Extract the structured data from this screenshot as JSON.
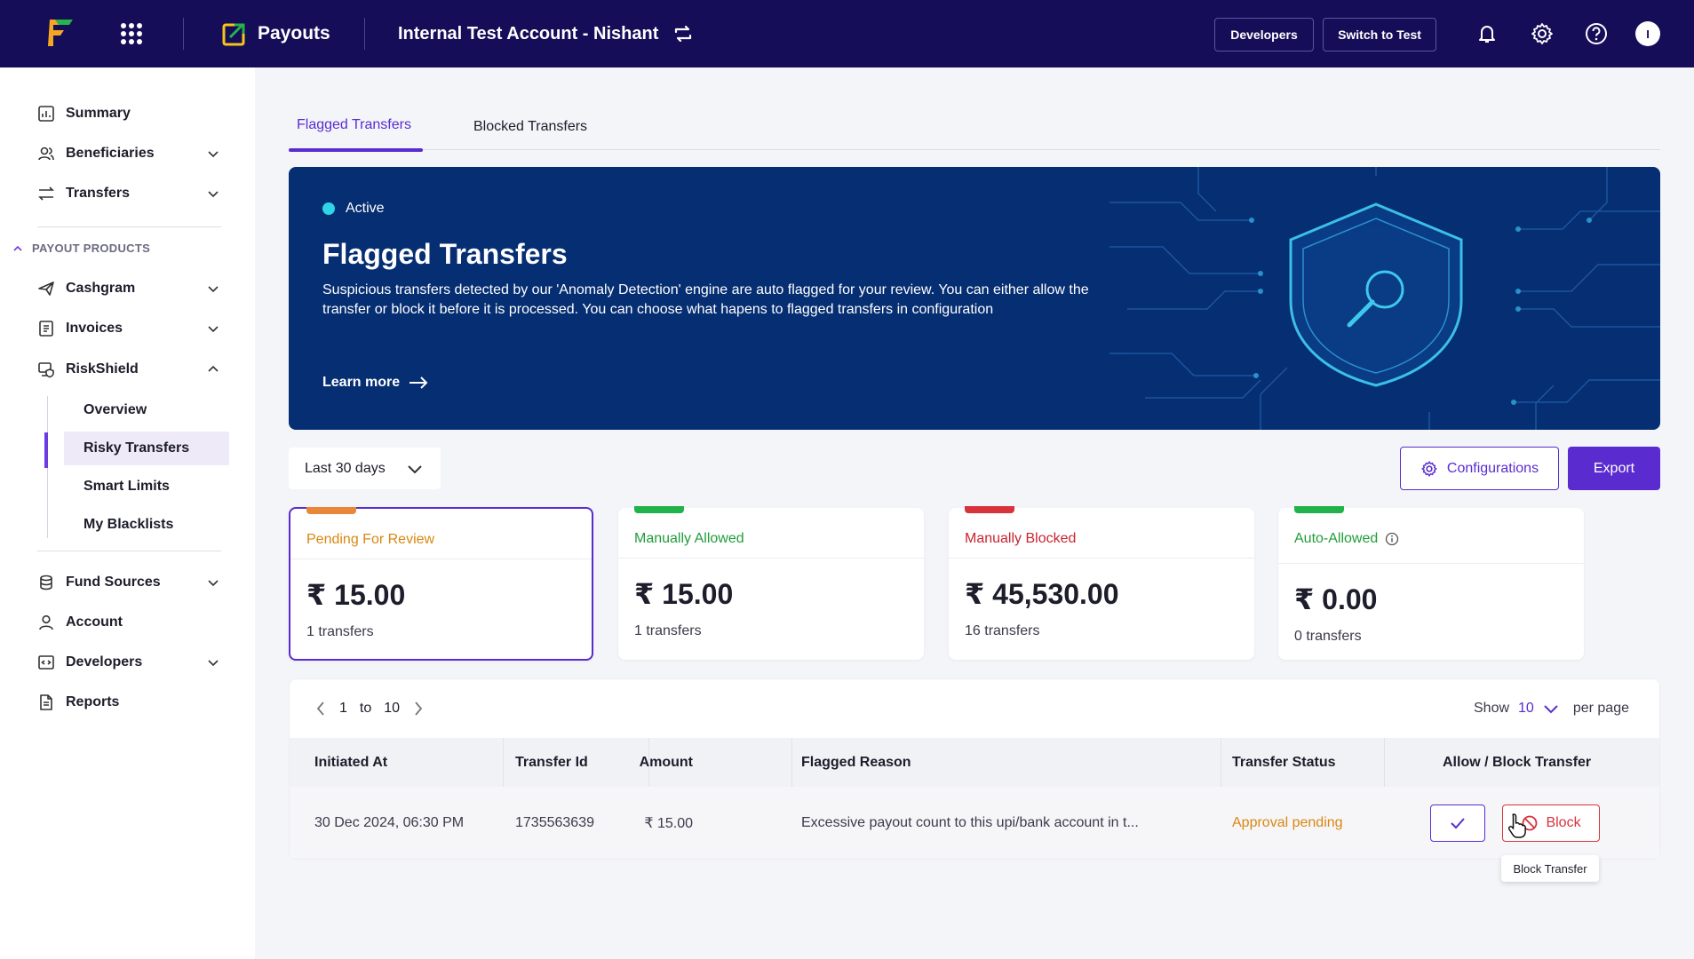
{
  "header": {
    "product": "Payouts",
    "account_name": "Internal Test Account - Nishant",
    "developers_label": "Developers",
    "switch_label": "Switch to Test",
    "avatar_initial": "I"
  },
  "sidebar": {
    "items": [
      {
        "label": "Summary"
      },
      {
        "label": "Beneficiaries"
      },
      {
        "label": "Transfers"
      }
    ],
    "section_label": "PAYOUT PRODUCTS",
    "products": [
      {
        "label": "Cashgram"
      },
      {
        "label": "Invoices"
      },
      {
        "label": "RiskShield"
      }
    ],
    "riskshield_sub": [
      {
        "label": "Overview"
      },
      {
        "label": "Risky Transfers"
      },
      {
        "label": "Smart Limits"
      },
      {
        "label": "My Blacklists"
      }
    ],
    "bottom": [
      {
        "label": "Fund Sources"
      },
      {
        "label": "Account"
      },
      {
        "label": "Developers"
      },
      {
        "label": "Reports"
      }
    ]
  },
  "tabs": [
    {
      "label": "Flagged Transfers",
      "active": true
    },
    {
      "label": "Blocked Transfers",
      "active": false
    }
  ],
  "banner": {
    "status": "Active",
    "title": "Flagged Transfers",
    "description": "Suspicious transfers detected by our 'Anomaly Detection' engine are auto flagged for your review. You can either allow the transfer or block it before it is processed. You can choose what hapens to flagged transfers in configuration",
    "learn_more": "Learn more"
  },
  "filters": {
    "date_range": "Last 30 days",
    "configurations_label": "Configurations",
    "export_label": "Export"
  },
  "cards": [
    {
      "label": "Pending For Review",
      "amount": "₹ 15.00",
      "count": "1 transfers",
      "color": "#d9870f",
      "tab_color": "#e8873a"
    },
    {
      "label": "Manually Allowed",
      "amount": "₹ 15.00",
      "count": "1 transfers",
      "color": "#1f9d3a",
      "tab_color": "#22b24a"
    },
    {
      "label": "Manually Blocked",
      "amount": "₹ 45,530.00",
      "count": "16 transfers",
      "color": "#c8242f",
      "tab_color": "#d8323c"
    },
    {
      "label": "Auto-Allowed",
      "amount": "₹ 0.00",
      "count": "0 transfers",
      "color": "#1f9d3a",
      "tab_color": "#22b24a"
    }
  ],
  "table": {
    "pager": {
      "from": "1",
      "to_label": "to",
      "to": "10"
    },
    "per_page": {
      "show_label": "Show",
      "value": "10",
      "suffix": "per page"
    },
    "columns": [
      "Initiated At",
      "Transfer Id",
      "Amount",
      "Flagged Reason",
      "Transfer Status",
      "Allow / Block Transfer"
    ],
    "rows": [
      {
        "initiated_at": "30 Dec 2024, 06:30 PM",
        "transfer_id": "1735563639",
        "amount": "₹ 15.00",
        "reason": "Excessive payout count to this upi/bank account in t...",
        "status": "Approval pending",
        "block_label": "Block"
      }
    ]
  },
  "tooltip": "Block Transfer",
  "colors": {
    "topbar": "#150d57",
    "accent": "#5a2ccf",
    "banner": "#062e72",
    "danger": "#d8323c",
    "warning": "#d9870f"
  }
}
